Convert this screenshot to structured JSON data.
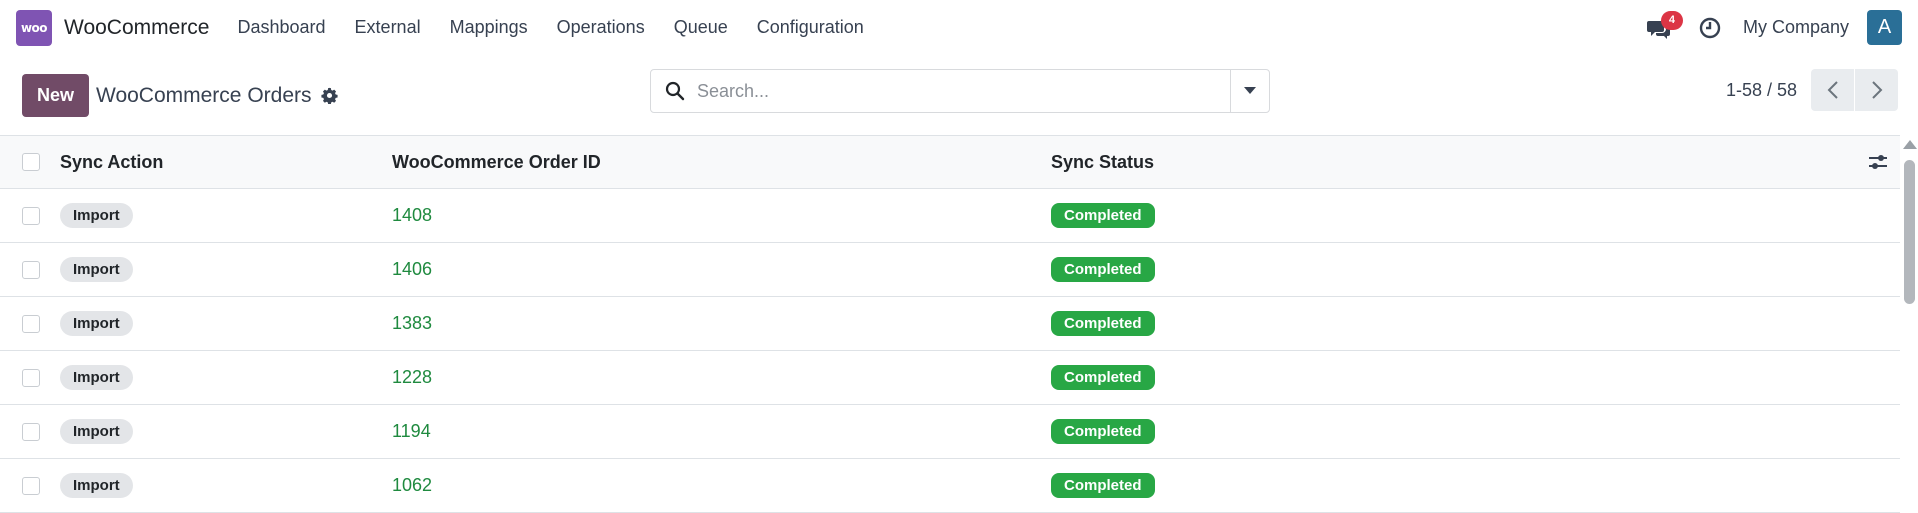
{
  "navbar": {
    "logo_text": "woo",
    "app_name": "WooCommerce",
    "menu": [
      "Dashboard",
      "External",
      "Mappings",
      "Operations",
      "Queue",
      "Configuration"
    ],
    "messages_badge": "4",
    "company": "My Company",
    "avatar_letter": "A"
  },
  "control": {
    "new_label": "New",
    "title": "WooCommerce Orders",
    "search_placeholder": "Search...",
    "pager": "1-58 / 58"
  },
  "list": {
    "columns": [
      "Sync Action",
      "WooCommerce Order ID",
      "Sync Status"
    ],
    "rows": [
      {
        "action": "Import",
        "order_id": "1408",
        "status": "Completed"
      },
      {
        "action": "Import",
        "order_id": "1406",
        "status": "Completed"
      },
      {
        "action": "Import",
        "order_id": "1383",
        "status": "Completed"
      },
      {
        "action": "Import",
        "order_id": "1228",
        "status": "Completed"
      },
      {
        "action": "Import",
        "order_id": "1194",
        "status": "Completed"
      },
      {
        "action": "Import",
        "order_id": "1062",
        "status": "Completed"
      }
    ]
  },
  "colors": {
    "brand": "#714b67",
    "woo": "#7f54b3",
    "completed": "#28a745",
    "badge": "#dc3545"
  }
}
